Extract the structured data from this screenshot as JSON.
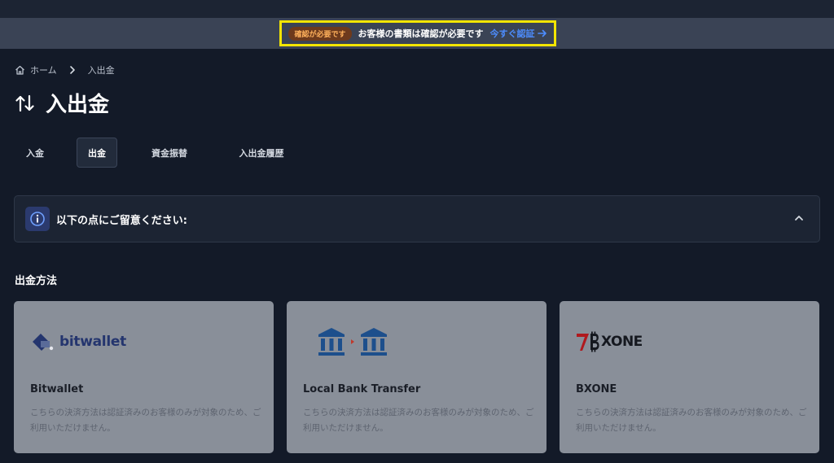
{
  "banner": {
    "badge": "確認が必要です",
    "message": "お客様の書類は確認が必要です",
    "link": "今すぐ認証"
  },
  "breadcrumb": {
    "home": "ホーム",
    "current": "入出金"
  },
  "page": {
    "title": "入出金"
  },
  "tabs": [
    {
      "label": "入金",
      "active": false
    },
    {
      "label": "出金",
      "active": true
    },
    {
      "label": "資金振替",
      "active": false
    },
    {
      "label": "入出金履歴",
      "active": false
    }
  ],
  "notice": {
    "text": "以下の点にご留意ください:"
  },
  "section": {
    "title": "出金方法"
  },
  "methods": [
    {
      "name": "Bitwallet",
      "logo_text": "bitwallet",
      "description": "こちらの決済方法は認証済みのお客様のみが対象のため、ご利用いただけません。"
    },
    {
      "name": "Local Bank Transfer",
      "logo_text": "",
      "description": "こちらの決済方法は認証済みのお客様のみが対象のため、ご利用いただけません。"
    },
    {
      "name": "BXONE",
      "logo_text": "XONE",
      "description": "こちらの決済方法は認証済みのお客様のみが対象のため、ご利用いただけません。"
    }
  ],
  "colors": {
    "background": "#131a28",
    "banner_bg": "#3a4355",
    "highlight_border": "#f3e500",
    "link": "#4d8dff",
    "badge_bg": "#6e3a1c",
    "card_bg": "#898f99"
  }
}
